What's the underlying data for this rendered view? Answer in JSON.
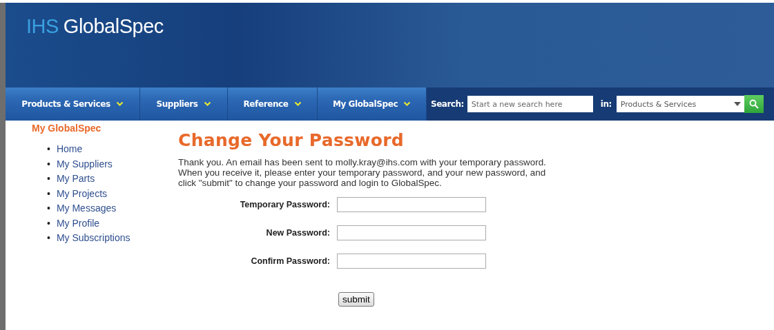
{
  "header": {
    "logo_prefix": "IHS",
    "logo_name": "GlobalSpec"
  },
  "nav": {
    "items": [
      {
        "label": "Products & Services",
        "selected": false
      },
      {
        "label": "Suppliers",
        "selected": false
      },
      {
        "label": "Reference",
        "selected": false
      },
      {
        "label": "My GlobalSpec",
        "selected": false
      }
    ],
    "search_label": "Search:",
    "search_placeholder": "Start a new search here",
    "in_label": "in:",
    "category": "Products & Services"
  },
  "sidebar": {
    "title": "My GlobalSpec",
    "bullet": "•",
    "items": [
      "Home",
      "My Suppliers",
      "My Parts",
      "My Projects",
      "My Messages",
      "My Profile",
      "My Subscriptions"
    ]
  },
  "main": {
    "title": "Change Your Password",
    "message_lines": [
      "Thank you. An email has been sent to molly.kray@ihs.com  with your temporary password.",
      "When you receive it, please enter your temporary password, and your new password, and",
      "click \"submit\" to change your password and login to GlobalSpec."
    ],
    "fields": [
      {
        "label": "Temporary Password:"
      },
      {
        "label": "New Password:"
      },
      {
        "label": "Confirm Password:"
      }
    ],
    "submit": "submit"
  }
}
